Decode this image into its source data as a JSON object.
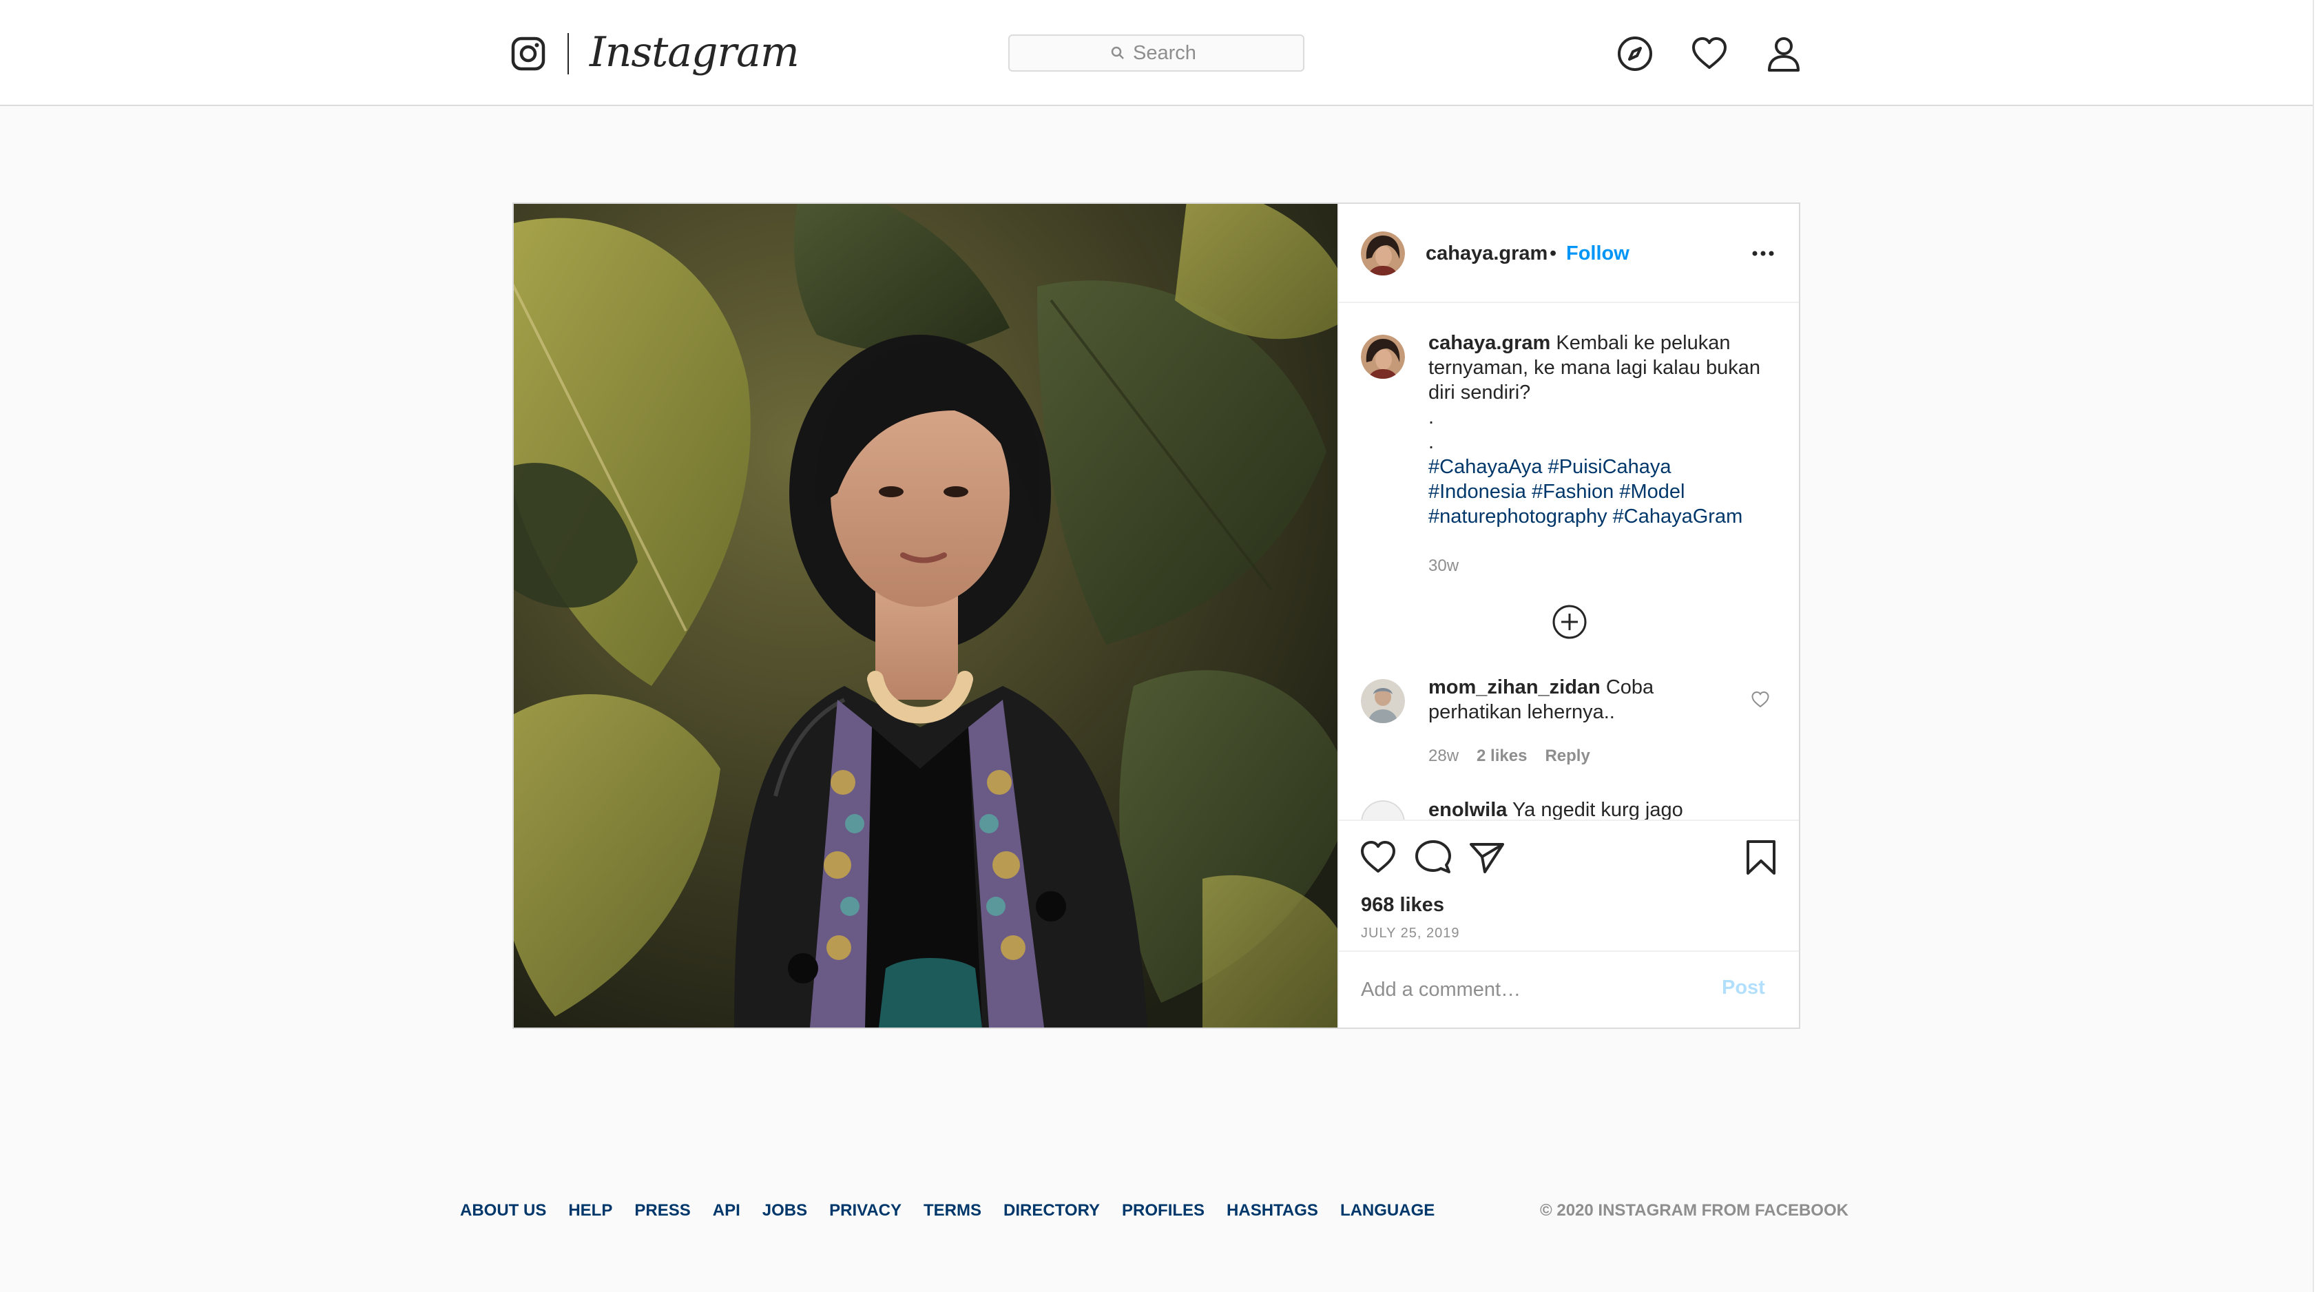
{
  "nav": {
    "logo_text": "Instagram",
    "search_placeholder": "Search",
    "icons": [
      "explore-compass-icon",
      "activity-heart-icon",
      "profile-icon"
    ]
  },
  "post": {
    "photo_alt": "Woman with short black hair in a black embroidered jacket with a floral scarf, standing among large green tropical leaves",
    "author": "cahaya.gram",
    "separator": "•",
    "follow_label": "Follow",
    "caption": {
      "username": "cahaya.gram",
      "text": "Kembali ke pelukan ternyaman, ke mana lagi kalau bukan diri sendiri?",
      "dot1": ".",
      "dot2": ".",
      "hashtags_line1": "#CahayaAya #PuisiCahaya",
      "hashtags_line2": "#Indonesia #Fashion #Model",
      "hashtags_line3": "#naturephotography #CahayaGram",
      "time": "30w"
    },
    "comments": [
      {
        "username": "mom_zihan_zidan",
        "text": "Coba perhatikan lehernya..",
        "time": "28w",
        "likes": "2 likes",
        "reply_label": "Reply"
      },
      {
        "username": "enolwila",
        "text": "Ya ngedit kurg jago"
      }
    ],
    "likes": "968 likes",
    "date": "JULY 25, 2019",
    "comment_placeholder": "Add a comment…",
    "post_label": "Post"
  },
  "footer": {
    "links": [
      "ABOUT US",
      "HELP",
      "PRESS",
      "API",
      "JOBS",
      "PRIVACY",
      "TERMS",
      "DIRECTORY",
      "PROFILES",
      "HASHTAGS",
      "LANGUAGE"
    ],
    "copyright": "© 2020 INSTAGRAM FROM FACEBOOK"
  },
  "colors": {
    "link_blue": "#0095f6",
    "hashtag_blue": "#00376b",
    "muted": "#8e8e8e",
    "text": "#262626",
    "border": "#dbdbdb"
  }
}
